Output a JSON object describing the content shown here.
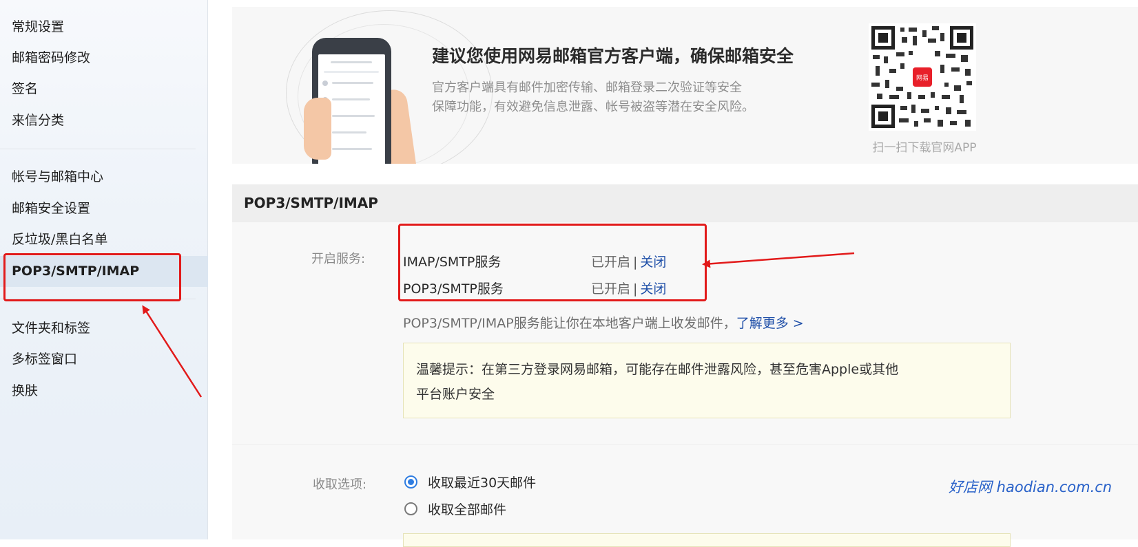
{
  "sidebar": {
    "items": [
      {
        "label": "常规设置"
      },
      {
        "label": "邮箱密码修改"
      },
      {
        "label": "签名"
      },
      {
        "label": "来信分类"
      },
      {
        "label": "帐号与邮箱中心"
      },
      {
        "label": "邮箱安全设置"
      },
      {
        "label": "反垃圾/黑白名单"
      },
      {
        "label": "POP3/SMTP/IMAP",
        "active": true
      },
      {
        "label": "文件夹和标签"
      },
      {
        "label": "多标签窗口"
      },
      {
        "label": "换肤"
      }
    ]
  },
  "banner": {
    "title": "建议您使用网易邮箱官方客户端，确保邮箱安全",
    "desc_line1": "官方客户端具有邮件加密传输、邮箱登录二次验证等安全",
    "desc_line2": "保障功能，有效避免信息泄露、帐号被盗等潜在安全风险。",
    "qr_caption": "扫一扫下载官网APP",
    "qr_badge": "网易"
  },
  "section": {
    "title": "POP3/SMTP/IMAP",
    "service_label": "开启服务:",
    "services": [
      {
        "name": "IMAP/SMTP服务",
        "status": "已开启",
        "sep": "|",
        "action": "关闭"
      },
      {
        "name": "POP3/SMTP服务",
        "status": "已开启",
        "sep": "|",
        "action": "关闭"
      }
    ],
    "desc_text": "POP3/SMTP/IMAP服务能让你在本地客户端上收发邮件，",
    "desc_link": "了解更多 >",
    "tip_line1": "温馨提示：在第三方登录网易邮箱，可能存在邮件泄露风险，甚至危害Apple或其他",
    "tip_line2": "平台账户安全",
    "fetch_label": "收取选项:",
    "fetch_options": [
      {
        "label": "收取最近30天邮件",
        "checked": true
      },
      {
        "label": "收取全部邮件",
        "checked": false
      }
    ]
  },
  "watermark": "好店网 haodian.com.cn",
  "colors": {
    "annotation": "#e21a1a",
    "link": "#1f4fa8",
    "radio_checked": "#2f7de1",
    "active_nav_bg": "#dce6f1"
  }
}
